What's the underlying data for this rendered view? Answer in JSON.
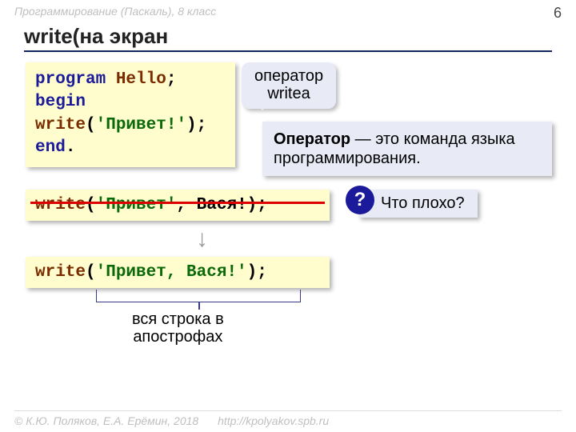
{
  "header": {
    "course": "Программирование (Паскаль), 8 класс",
    "page": "6"
  },
  "title": "write(на экран",
  "code_main": {
    "l1a": "program",
    "l1b": " Hello",
    "l1c": ";",
    "l2": "begin",
    "l3a": "  write",
    "l3b": "(",
    "l3c": "'Привет!'",
    "l3d": ");",
    "l4a": "end",
    "l4b": "."
  },
  "callout": {
    "line1": "оператор",
    "line2": "writeа"
  },
  "definition": {
    "bold": "Оператор",
    "rest": " — это команда языка программирования."
  },
  "code_bad": {
    "a": "write",
    "b": "(",
    "c": "'Привет'",
    "d": ", Вася!);"
  },
  "question": {
    "mark": "?",
    "text": "Что плохо?"
  },
  "code_good": {
    "a": "write",
    "b": "(",
    "c": "'Привет, Вася!'",
    "d": ");"
  },
  "bracket_label": {
    "line1": "вся строка в",
    "line2": "апострофах"
  },
  "footer": {
    "copyright": "© К.Ю. Поляков, Е.А. Ерёмин, 2018",
    "url": "http://kpolyakov.spb.ru"
  }
}
